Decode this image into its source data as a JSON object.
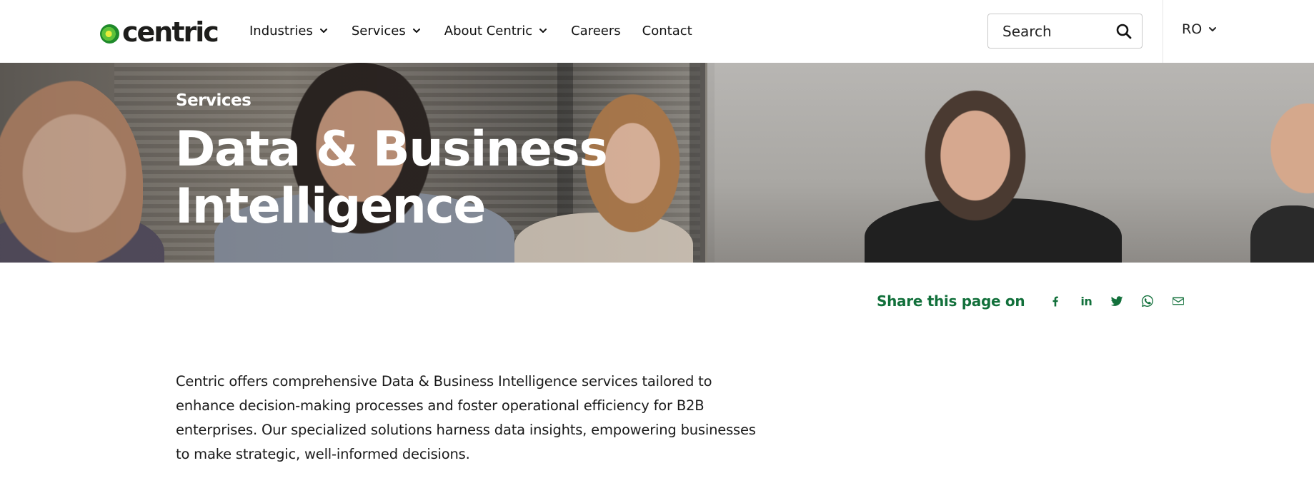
{
  "brand": {
    "name": "centric",
    "accent": "#12703b"
  },
  "nav": {
    "items": [
      {
        "label": "Industries",
        "has_dropdown": true
      },
      {
        "label": "Services",
        "has_dropdown": true
      },
      {
        "label": "About Centric",
        "has_dropdown": true
      },
      {
        "label": "Careers",
        "has_dropdown": false
      },
      {
        "label": "Contact",
        "has_dropdown": false
      }
    ]
  },
  "search": {
    "placeholder": "Search",
    "icon": "search-icon"
  },
  "language": {
    "current": "RO",
    "icon": "chevron-down-icon"
  },
  "hero": {
    "eyebrow": "Services",
    "title_line1": "Data & Business",
    "title_line2": "Intelligence"
  },
  "share": {
    "label": "Share this page on",
    "icons": [
      "facebook-icon",
      "linkedin-icon",
      "twitter-icon",
      "whatsapp-icon",
      "email-icon"
    ]
  },
  "intro": {
    "text": "Centric offers comprehensive Data & Business Intelligence services tailored to enhance decision-making processes and foster operational efficiency for B2B enterprises. Our specialized solutions harness data insights, empowering businesses to make strategic, well-informed decisions."
  }
}
